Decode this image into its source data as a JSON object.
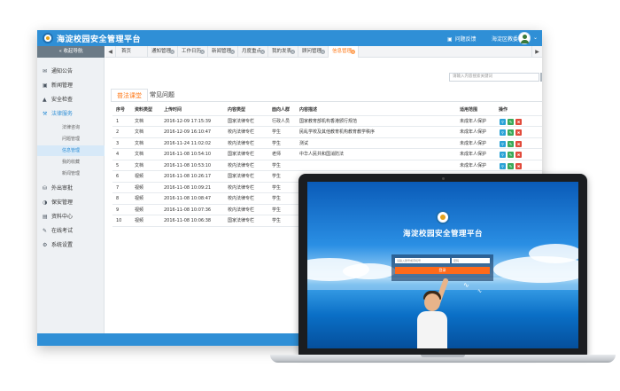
{
  "app": {
    "title": "海淀校园安全管理平台",
    "feedback": "问题反馈",
    "user": "海淀区教委",
    "nav_toggle": "« 收起导航"
  },
  "sidebar": {
    "items": [
      {
        "label": "通知公告",
        "icon": "mail-icon"
      },
      {
        "label": "新闻管理",
        "icon": "monitor-icon"
      },
      {
        "label": "安全检查",
        "icon": "warning-icon"
      },
      {
        "label": "法律服务",
        "icon": "hammer-icon"
      },
      {
        "label": "外出审批",
        "icon": "car-icon"
      },
      {
        "label": "保安管理",
        "icon": "shield-icon"
      },
      {
        "label": "资料中心",
        "icon": "document-icon"
      },
      {
        "label": "在线考试",
        "icon": "pencil-icon"
      },
      {
        "label": "系统设置",
        "icon": "gear-icon"
      }
    ],
    "sub_items": [
      "法律咨询",
      "问题管理",
      "信息管理",
      "我的收藏",
      "新闻管理"
    ]
  },
  "tabs": [
    "首页",
    "通知管理",
    "工作日历",
    "新闻管理",
    "月度重点",
    "我的发表",
    "顾问管理",
    "信息管理"
  ],
  "search": {
    "placeholder": "请输入内容搜索关键词",
    "upload_label": "上传"
  },
  "content_tabs": [
    "普法课堂",
    "常见问题"
  ],
  "table": {
    "headers": [
      "序号",
      "资料类型",
      "上传时间",
      "内容类型",
      "面向人群",
      "内容描述",
      "适用范围",
      "操作"
    ],
    "rows": [
      [
        "1",
        "文档",
        "2016-12-09 17:15:39",
        "国家法律专栏",
        "行政人员",
        "国家教育部机构香港颁行规范",
        "未成年人保护"
      ],
      [
        "2",
        "文档",
        "2016-12-09 16:10:47",
        "校内法律专栏",
        "学生",
        "民乱学校及其他教育机构教育教学秩序",
        "未成年人保护"
      ],
      [
        "3",
        "文档",
        "2016-11-24 11:02:02",
        "校内法律专栏",
        "学生",
        "测试",
        "未成年人保护"
      ],
      [
        "4",
        "文档",
        "2016-11-08 10:54:10",
        "国家法律专栏",
        "老师",
        "中华人民共和国消防法",
        "未成年人保护"
      ],
      [
        "5",
        "文档",
        "2016-11-08 10:53:10",
        "校内法律专栏",
        "学生",
        "",
        "未成年人保护"
      ],
      [
        "6",
        "视频",
        "2016-11-08 10:26:17",
        "国家法律专栏",
        "学生",
        "",
        ""
      ],
      [
        "7",
        "视频",
        "2016-11-08 10:09:21",
        "校内法律专栏",
        "学生",
        "",
        ""
      ],
      [
        "8",
        "视频",
        "2016-11-08 10:08:47",
        "校内法律专栏",
        "学生",
        "",
        ""
      ],
      [
        "9",
        "视频",
        "2016-11-08 10:07:36",
        "校内法律专栏",
        "学生",
        "",
        ""
      ],
      [
        "10",
        "视频",
        "2016-11-08 10:06:38",
        "国家法律专栏",
        "学生",
        "",
        ""
      ]
    ]
  },
  "laptop": {
    "title": "海淀校园安全管理平台",
    "username_placeholder": "请输入账号或手机号",
    "password_placeholder": "密码",
    "login_button": "登录"
  },
  "colors": {
    "primary": "#2f8fd6",
    "accent": "#ff7a1a",
    "upload": "#ff9a1f"
  }
}
